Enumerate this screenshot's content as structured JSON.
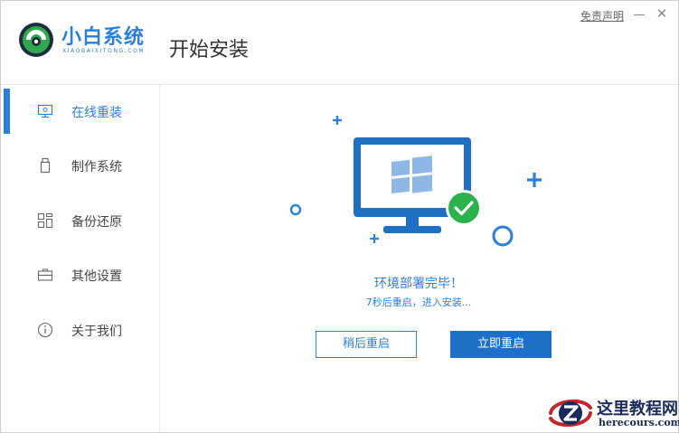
{
  "app": {
    "brand_name": "小白系统",
    "brand_domain": "XIAOBAIXITONG.COM",
    "page_title": "开始安装"
  },
  "window_controls": {
    "disclaimer": "免责声明",
    "minimize_icon": "minimize-icon",
    "close_icon": "close-icon",
    "close_glyph": "✕"
  },
  "sidebar": {
    "items": [
      {
        "label": "在线重装",
        "icon": "monitor-icon",
        "active": true
      },
      {
        "label": "制作系统",
        "icon": "usb-drive-icon",
        "active": false
      },
      {
        "label": "备份还原",
        "icon": "backup-grid-icon",
        "active": false
      },
      {
        "label": "其他设置",
        "icon": "toolbox-icon",
        "active": false
      },
      {
        "label": "关于我们",
        "icon": "info-icon",
        "active": false
      }
    ]
  },
  "main": {
    "status_title": "环境部署完毕！",
    "status_detail": "7秒后重启，进入安装...",
    "restart_later_label": "稍后重启",
    "restart_now_label": "立即重启"
  },
  "watermark": {
    "title": "这里教程网",
    "url": "herecours.com"
  },
  "colors": {
    "accent": "#2b7fd6",
    "button_primary": "#1e6fc8",
    "success": "#2bb24c"
  }
}
